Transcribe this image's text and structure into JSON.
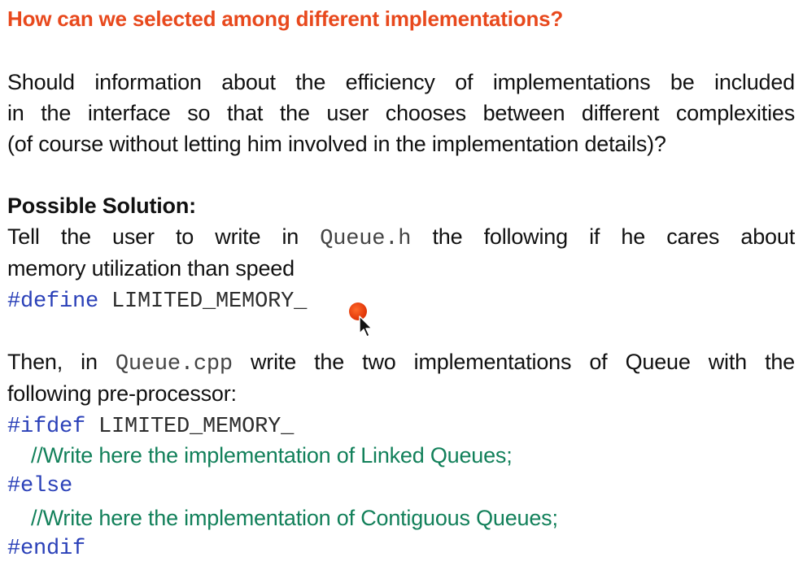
{
  "slide": {
    "title": "How can we selected among different implementations?",
    "question_lines": [
      "Should information about the efficiency of implementations be included",
      "in the interface so that the user chooses between different complexities",
      "(of course without letting him involved in the implementation details)?"
    ],
    "solution_heading": "Possible Solution:",
    "solution_line1_before": "Tell the user to write in ",
    "solution_line1_code": "Queue.h",
    "solution_line1_after": " the following if he cares about",
    "solution_line2": "memory utilization than speed",
    "define_directive": "#define",
    "define_macro": " LIMITED_MEMORY_",
    "then_before": "Then, in ",
    "then_code": "Queue.cpp",
    "then_after": " write the two implementations of Queue with the",
    "then_line2": "following pre-processor:",
    "ifdef_directive": "#ifdef",
    "ifdef_macro": " LIMITED_MEMORY_",
    "comment_linked": "//Write here the implementation of Linked Queues;",
    "else_directive": "#else",
    "comment_contiguous": "//Write here the implementation of Contiguous Queues;",
    "endif_directive": "#endif"
  },
  "colors": {
    "title": "#e8491d",
    "directive": "#2a40b8",
    "comment": "#12805a",
    "laser_pointer": "#e43b0c"
  },
  "icons": [
    "laser-pointer-dot",
    "mouse-cursor-icon"
  ]
}
